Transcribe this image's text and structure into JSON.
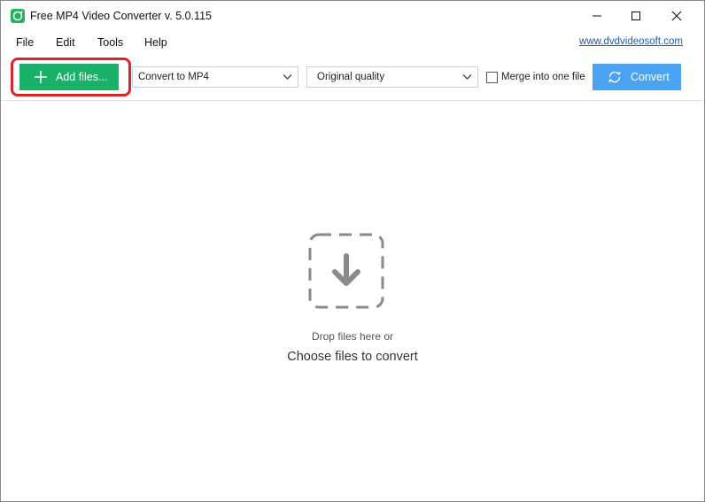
{
  "window": {
    "title": "Free MP4 Video Converter v. 5.0.115",
    "minimize_icon": "minimize-icon",
    "maximize_icon": "maximize-icon",
    "close_icon": "close-icon"
  },
  "menu": {
    "items": [
      {
        "label": "File"
      },
      {
        "label": "Edit"
      },
      {
        "label": "Tools"
      },
      {
        "label": "Help"
      }
    ],
    "site_link": "www.dvdvideosoft.com"
  },
  "toolbar": {
    "add_files_label": "Add files...",
    "format_select": "Convert to MP4",
    "quality_select": "Original quality",
    "merge_label": "Merge into one file",
    "merge_checked": false,
    "convert_label": "Convert"
  },
  "dropzone": {
    "line1": "Drop files here or",
    "line2": "Choose files to convert"
  },
  "colors": {
    "add_button": "#17b169",
    "convert_button": "#4ba3f4",
    "highlight": "#d9262c",
    "link": "#1a5fb4"
  }
}
